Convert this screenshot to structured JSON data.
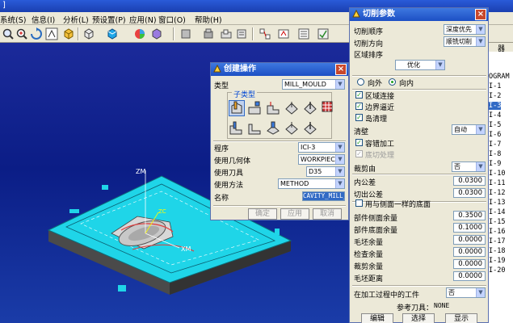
{
  "titlebar": {
    "text": "]"
  },
  "menu": [
    "系统(S)",
    "信息(I)",
    "分析(L)",
    "预设置(P)",
    "应用(N)",
    "窗口(O)",
    "帮助(H)"
  ],
  "navigator": {
    "header": "器",
    "items": [
      "OGRAM",
      "I-1",
      "I-2",
      "I-3",
      "I-4",
      "I-5",
      "I-6",
      "I-7",
      "I-8",
      "I-9",
      "I-10",
      "I-11",
      "I-12",
      "I-13",
      "I-14",
      "I-15",
      "I-16",
      "I-17",
      "I-18",
      "I-19",
      "I-20"
    ],
    "selected_index": 3
  },
  "create_op": {
    "title": "创建操作",
    "type_label": "类型",
    "type_value": "MILL_MOULD",
    "subtype_label": "子类型",
    "program_label": "程序",
    "program_value": "ICI-3",
    "geometry_label": "使用几何体",
    "geometry_value": "WORKPIECE",
    "tool_label": "使用刀具",
    "tool_value": "D35",
    "method_label": "使用方法",
    "method_value": "METHOD",
    "name_label": "名称",
    "name_value": "CAVITY_MILL_",
    "ok": "确定",
    "apply": "应用",
    "cancel": "取消"
  },
  "cut_params": {
    "title": "切削参数",
    "cut_order_label": "切削顺序",
    "cut_order_value": "深度优先",
    "cut_dir_label": "切削方向",
    "cut_dir_value": "顺铣切削",
    "region_sort_label": "区域排序",
    "region_sort_value": "优化",
    "outward": "向外",
    "inward": "向内",
    "region_connect": "区域连接",
    "boundary_approx": "边界逼近",
    "island_clean": "岛清理",
    "wall_clean_label": "清壁",
    "wall_clean_value": "自动",
    "tolerant_machining": "容错加工",
    "undercut": "底切处理",
    "trim_label": "裁剪由",
    "trim_value": "否",
    "intol_label": "内公差",
    "intol_value": "0.0300",
    "outtol_label": "切出公差",
    "outtol_value": "0.0300",
    "same_floor": "用与侧面一样的底面",
    "side_stock_label": "部件侧面余量",
    "side_stock_value": "0.3500",
    "floor_stock_label": "部件底面余量",
    "floor_stock_value": "0.1000",
    "blank_stock_label": "毛坯余量",
    "blank_stock_value": "0.0000",
    "check_stock_label": "检查余量",
    "check_stock_value": "0.0000",
    "trim_stock_label": "裁剪余量",
    "trim_stock_value": "0.0000",
    "blank_dist_label": "毛坯距离",
    "blank_dist_value": "0.0000",
    "ipw_label": "在加工过程中的工件",
    "ipw_value": "否",
    "ref_tool_label": "参考刀具：",
    "ref_tool_value": "NONE",
    "edit": "编辑",
    "select": "选择",
    "display": "显示"
  },
  "viewport": {
    "axis_zm": "ZM",
    "axis_xm": "XM",
    "axis_zc": "ZC"
  },
  "colors": {
    "part": "#1fd5e8",
    "background": "#0b1d86",
    "accent": "#316ac5"
  }
}
